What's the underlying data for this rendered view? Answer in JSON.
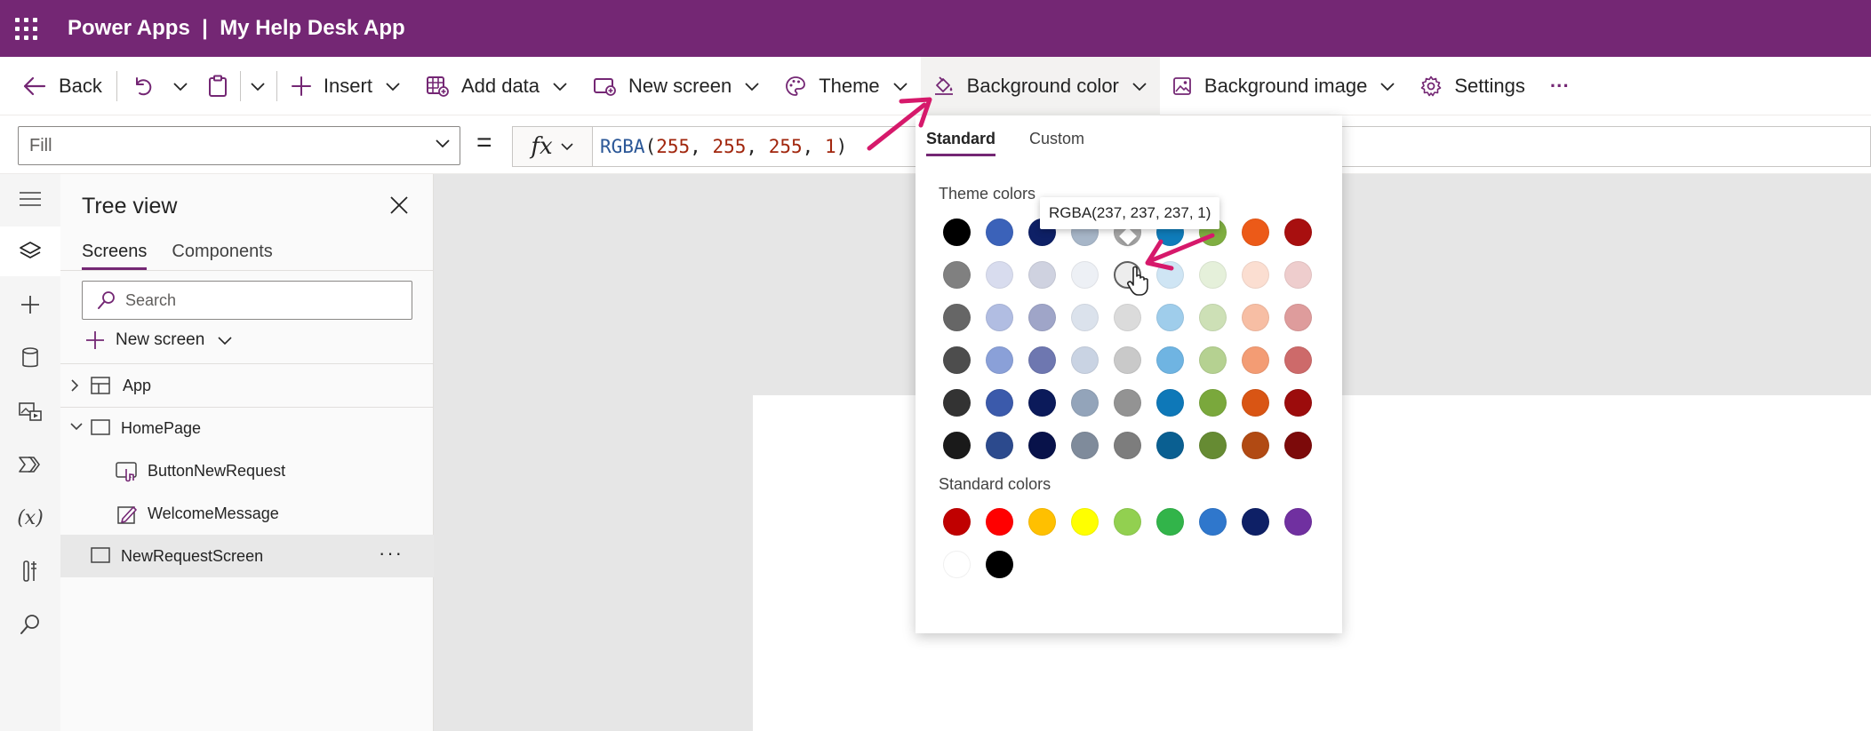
{
  "app": {
    "title": "Power Apps  |  My Help Desk App",
    "accent": "#742774"
  },
  "command_bar": {
    "back": "Back",
    "insert": "Insert",
    "add_data": "Add data",
    "new_screen": "New screen",
    "theme": "Theme",
    "background_color": "Background color",
    "background_image": "Background image",
    "settings": "Settings",
    "more": "···"
  },
  "formula_bar": {
    "property": "Fill",
    "equals": "=",
    "fx": "fx",
    "formula_fn": "RGBA",
    "formula_args": [
      "255",
      "255",
      "255",
      "1"
    ]
  },
  "left_rail": {
    "icons": [
      "hamburger-icon",
      "layers-icon",
      "plus-icon",
      "database-icon",
      "media-icon",
      "power-automate-icon",
      "variables-icon",
      "tools-icon",
      "search-icon"
    ],
    "variables_label": "(x)"
  },
  "tree_view": {
    "title": "Tree view",
    "tabs": [
      "Screens",
      "Components"
    ],
    "selected_tab": "Screens",
    "search_placeholder": "Search",
    "new_screen": "New screen",
    "items": [
      {
        "label": "App",
        "type": "app",
        "expanded": false
      },
      {
        "label": "HomePage",
        "type": "screen",
        "expanded": true
      },
      {
        "label": "ButtonNewRequest",
        "type": "button"
      },
      {
        "label": "WelcomeMessage",
        "type": "label"
      },
      {
        "label": "NewRequestScreen",
        "type": "screen",
        "selected": true
      }
    ],
    "more": "···"
  },
  "color_picker": {
    "tabs": [
      "Standard",
      "Custom"
    ],
    "selected_tab": "Standard",
    "theme_colors_label": "Theme colors",
    "standard_colors_label": "Standard colors",
    "tooltip": "RGBA(237, 237, 237, 1)",
    "hovered_swatch": "#ededed",
    "theme_colors": [
      [
        "#000000",
        "#3b62b9",
        "#0e2066",
        "#a7b6c8",
        "#a6a6a6",
        "#0f7cba",
        "#7fae41",
        "#ec5a18",
        "#a80f0f"
      ],
      [
        "#808080",
        "#d8dcee",
        "#cfd2e0",
        "#edf0f5",
        "#ededed",
        "#cfe5f4",
        "#e5f0da",
        "#fbded1",
        "#eecdcd"
      ],
      [
        "#666666",
        "#b1bde2",
        "#9fa5c8",
        "#dbe2ec",
        "#dbdbdb",
        "#9fcdeb",
        "#cde0b6",
        "#f7bea4",
        "#de9c9c"
      ],
      [
        "#4d4d4d",
        "#8aa0d8",
        "#6e77b0",
        "#c9d3e3",
        "#c9c9c9",
        "#6fb4e2",
        "#b5d191",
        "#f39c74",
        "#cd6a6a"
      ],
      [
        "#333333",
        "#3b5aab",
        "#0b1a5a",
        "#93a4ba",
        "#939393",
        "#0e78b8",
        "#7aa83c",
        "#d95514",
        "#9c0c0c"
      ],
      [
        "#1a1a1a",
        "#2c4a8d",
        "#08124a",
        "#7f8b9b",
        "#7d7d7d",
        "#0a5f91",
        "#668b33",
        "#b14a13",
        "#7c0a0a"
      ]
    ],
    "standard_colors": [
      [
        "#c00000",
        "#ff0000",
        "#ffc000",
        "#ffff00",
        "#92d050",
        "#32b44a",
        "#2f77cc",
        "#0e2066",
        "#7030a0"
      ],
      [
        "#ffffff",
        "#000000"
      ]
    ]
  }
}
